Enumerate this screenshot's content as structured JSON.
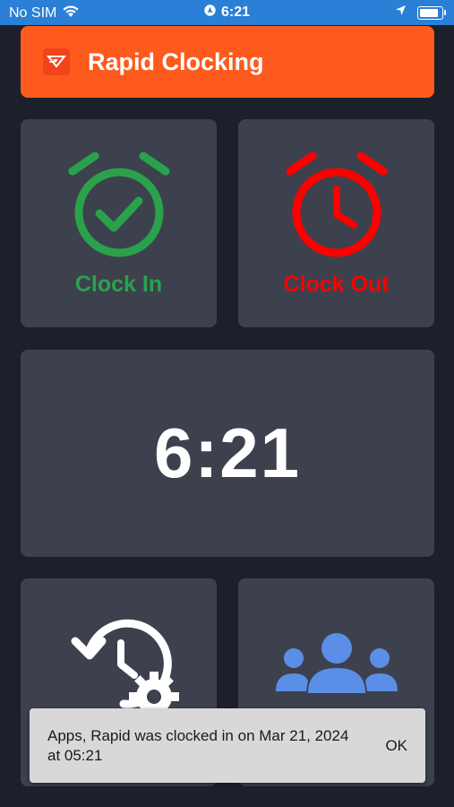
{
  "status_bar": {
    "carrier": "No SIM",
    "time": "6:21"
  },
  "header": {
    "title": "Rapid Clocking",
    "logo_icon": "rapid-logo-icon",
    "background": "#fe5a1e"
  },
  "tiles": {
    "clock_in": {
      "label": "Clock In",
      "icon": "alarm-clock-check-icon",
      "color": "#2aa24b"
    },
    "clock_out": {
      "label": "Clock Out",
      "icon": "alarm-clock-icon",
      "color": "#fe0000"
    },
    "current_time": "6:21",
    "history": {
      "icon": "history-settings-icon"
    },
    "team": {
      "icon": "group-icon",
      "color": "#5b8ee6"
    }
  },
  "toast": {
    "message": "Apps, Rapid was clocked in on Mar 21, 2024 at 05:21",
    "action": "OK"
  }
}
